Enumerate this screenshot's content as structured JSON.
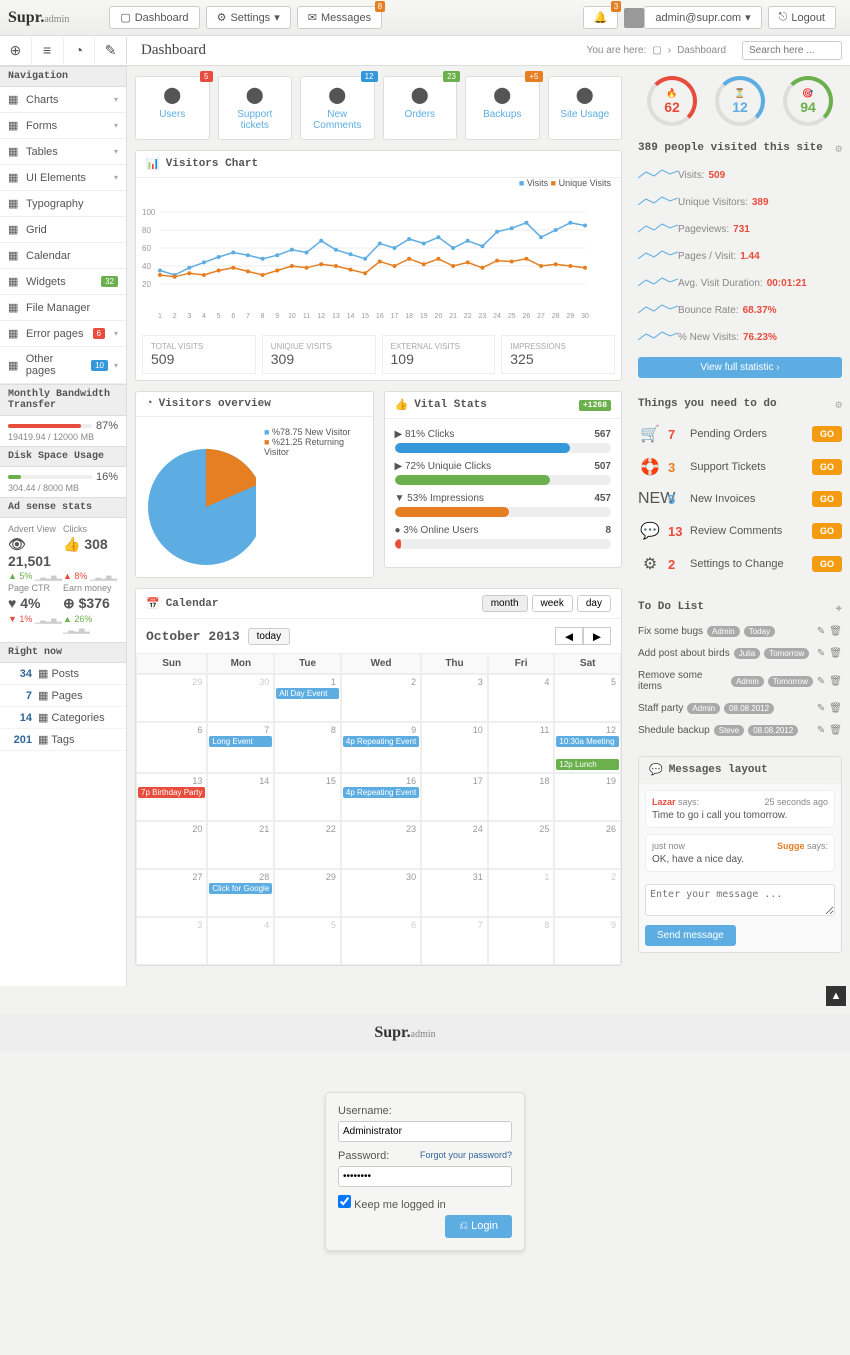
{
  "brand": {
    "main": "Supr.",
    "sub": "admin"
  },
  "header": {
    "dashboard": "Dashboard",
    "settings": "Settings",
    "messages": "Messages",
    "messages_badge": "8",
    "notif_badge": "3",
    "user": "admin@supr.com",
    "logout": "Logout"
  },
  "toolbar": {
    "title": "Dashboard",
    "you_are_here": "You are here:",
    "crumb": "Dashboard",
    "search_ph": "Search here ..."
  },
  "nav": {
    "title": "Navigation",
    "items": [
      {
        "label": "Charts",
        "caret": true
      },
      {
        "label": "Forms",
        "caret": true
      },
      {
        "label": "Tables",
        "caret": true
      },
      {
        "label": "UI Elements",
        "caret": true
      },
      {
        "label": "Typography"
      },
      {
        "label": "Grid"
      },
      {
        "label": "Calendar"
      },
      {
        "label": "Widgets",
        "badge": "32",
        "cls": "green"
      },
      {
        "label": "File Manager"
      },
      {
        "label": "Error pages",
        "badge": "6",
        "cls": "red",
        "caret": true
      },
      {
        "label": "Other pages",
        "badge": "10",
        "cls": "blue",
        "caret": true
      }
    ]
  },
  "bandwidth": {
    "title": "Monthly Bandwidth Transfer",
    "text": "19419.94 / 12000 MB",
    "pct": "87%",
    "fill": 87
  },
  "disk": {
    "title": "Disk Space Usage",
    "text": "304.44 / 8000 MB",
    "pct": "16%",
    "fill": 16
  },
  "adsense": {
    "title": "Ad sense stats",
    "col1": {
      "label": "Advert View",
      "num": "21,501",
      "delta": "5%"
    },
    "col2": {
      "label": "Clicks",
      "num": "308",
      "delta": "8%"
    },
    "col3": {
      "label": "Page CTR",
      "num": "4%",
      "delta": ""
    },
    "col4": {
      "label": "Earn money",
      "num": "$376",
      "delta": "26%"
    }
  },
  "rightnow": {
    "title": "Right now",
    "rows": [
      {
        "n": "34",
        "label": "Posts"
      },
      {
        "n": "7",
        "label": "Pages"
      },
      {
        "n": "14",
        "label": "Categories"
      },
      {
        "n": "201",
        "label": "Tags"
      }
    ]
  },
  "tiles": [
    {
      "label": "Users",
      "badge": "5",
      "cls": "red",
      "color": "#5dade2"
    },
    {
      "label": "Support tickets",
      "color": "#5dade2"
    },
    {
      "label": "New Comments",
      "badge": "12",
      "cls": "blue",
      "color": "#5dade2"
    },
    {
      "label": "Orders",
      "badge": "23",
      "cls": "green",
      "color": "#5dade2"
    },
    {
      "label": "Backups",
      "badge": "+5",
      "cls": "orange",
      "color": "#5dade2"
    },
    {
      "label": "Site Usage",
      "color": "#5dade2"
    }
  ],
  "chart": {
    "title": "Visitors Chart",
    "legend": [
      "Visits",
      "Unique Visits"
    ],
    "y_ticks": [
      20,
      40,
      60,
      80,
      100
    ],
    "x_ticks": [
      "1",
      "2",
      "3",
      "4",
      "5",
      "6",
      "7",
      "8",
      "9",
      "10",
      "11",
      "12",
      "13",
      "14",
      "15",
      "16",
      "17",
      "18",
      "19",
      "20",
      "21",
      "22",
      "23",
      "24",
      "25",
      "26",
      "27",
      "28",
      "29",
      "30"
    ],
    "stats": [
      {
        "label": "TOTAL VISITS",
        "value": "509"
      },
      {
        "label": "UNIQIUE VISITS",
        "value": "309"
      },
      {
        "label": "EXTERNAL VISITS",
        "value": "109"
      },
      {
        "label": "IMPRESSIONS",
        "value": "325"
      }
    ]
  },
  "chart_data": {
    "type": "line",
    "x": [
      1,
      2,
      3,
      4,
      5,
      6,
      7,
      8,
      9,
      10,
      11,
      12,
      13,
      14,
      15,
      16,
      17,
      18,
      19,
      20,
      21,
      22,
      23,
      24,
      25,
      26,
      27,
      28,
      29,
      30
    ],
    "series": [
      {
        "name": "Visits",
        "color": "#5dade2",
        "values": [
          35,
          30,
          38,
          44,
          50,
          55,
          52,
          48,
          52,
          58,
          55,
          68,
          58,
          53,
          48,
          65,
          60,
          70,
          65,
          72,
          60,
          68,
          62,
          78,
          82,
          88,
          72,
          80,
          88,
          85
        ]
      },
      {
        "name": "Unique Visits",
        "color": "#e67e22",
        "values": [
          30,
          28,
          32,
          30,
          35,
          38,
          34,
          30,
          35,
          40,
          38,
          42,
          40,
          36,
          32,
          45,
          40,
          48,
          42,
          48,
          40,
          44,
          38,
          46,
          45,
          48,
          40,
          42,
          40,
          38
        ]
      }
    ],
    "ylim": [
      0,
      100
    ],
    "pie": {
      "type": "pie",
      "slices": [
        {
          "label": "%78.75 New Visitor",
          "value": 78.75,
          "color": "#5dade2"
        },
        {
          "label": "%21.25 Returning Visitor",
          "value": 21.25,
          "color": "#e67e22"
        }
      ]
    }
  },
  "overview": {
    "title": "Visitors overview"
  },
  "vital": {
    "title": "Vital Stats",
    "badge": "+1268",
    "rows": [
      {
        "caret": "▶",
        "label": "81% Clicks",
        "val": "567",
        "pct": 81,
        "color": "#3498db"
      },
      {
        "caret": "▶",
        "label": "72% Uniquie Clicks",
        "val": "507",
        "pct": 72,
        "color": "#6ab04c"
      },
      {
        "caret": "▼",
        "label": "53% Impressions",
        "val": "457",
        "pct": 53,
        "color": "#e67e22"
      },
      {
        "caret": "●",
        "label": "3% Online Users",
        "val": "8",
        "pct": 3,
        "color": "#e74c3c"
      }
    ]
  },
  "gauges": [
    {
      "num": "62",
      "color": "#e74c3c",
      "icon": "🔥"
    },
    {
      "num": "12",
      "color": "#5dade2",
      "icon": "⏳"
    },
    {
      "num": "94",
      "color": "#6ab04c",
      "icon": "🎯"
    }
  ],
  "site_stats": {
    "title": "389 people visited this site",
    "rows": [
      {
        "label": "Visits:",
        "val": "509"
      },
      {
        "label": "Unique Visitors:",
        "val": "389"
      },
      {
        "label": "Pageviews:",
        "val": "731"
      },
      {
        "label": "Pages / Visit:",
        "val": "1.44"
      },
      {
        "label": "Avg. Visit Duration:",
        "val": "00:01:21"
      },
      {
        "label": "Bounce Rate:",
        "val": "68.37%"
      },
      {
        "label": "% New Visits:",
        "val": "76.23%"
      }
    ],
    "button": "View full statistic ›"
  },
  "actions": {
    "title": "Things you need to do",
    "rows": [
      {
        "icon": "🛒",
        "num": "7",
        "label": "Pending Orders",
        "color": "#e74c3c"
      },
      {
        "icon": "🛟",
        "num": "3",
        "label": "Support Tickets",
        "color": "#e67e22"
      },
      {
        "icon": "NEW",
        "num": "5",
        "label": "New Invoices",
        "color": "#5dade2"
      },
      {
        "icon": "💬",
        "num": "13",
        "label": "Review Comments",
        "color": "#e74c3c"
      },
      {
        "icon": "⚙",
        "num": "2",
        "label": "Settings to Change",
        "color": "#e74c3c"
      }
    ],
    "go": "GO"
  },
  "todolist": {
    "title": "To Do List",
    "items": [
      {
        "text": "Fix some bugs",
        "who": "Admin",
        "when": "Today",
        "wcls": "red"
      },
      {
        "text": "Add post about birds",
        "who": "Julia",
        "when": "Tomorrow",
        "wcls": "green"
      },
      {
        "text": "Remove some items",
        "who": "Admin",
        "when": "Tomorrow",
        "wcls": "green"
      },
      {
        "text": "Staff party",
        "who": "Admin",
        "when": "08.08.2012",
        "wcls": "blue"
      },
      {
        "text": "Shedule backup",
        "who": "Steve",
        "when": "08.08.2012",
        "wcls": "blue"
      }
    ]
  },
  "calendar": {
    "title": "Calendar",
    "month": "October 2013",
    "today": "today",
    "views": [
      "month",
      "week",
      "day"
    ],
    "days": [
      "Sun",
      "Mon",
      "Tue",
      "Wed",
      "Thu",
      "Fri",
      "Sat"
    ],
    "cells": [
      {
        "n": "29",
        "o": 1
      },
      {
        "n": "30",
        "o": 1
      },
      {
        "n": "1",
        "evts": [
          {
            "t": "All Day Event",
            "c": "#5dade2"
          }
        ]
      },
      {
        "n": "2"
      },
      {
        "n": "3"
      },
      {
        "n": "4"
      },
      {
        "n": "5"
      },
      {
        "n": "6"
      },
      {
        "n": "7",
        "evts": [
          {
            "t": "Long Event",
            "c": "#5dade2",
            "span": 3
          }
        ]
      },
      {
        "n": "8"
      },
      {
        "n": "9",
        "evts": [
          {
            "t": "4p Repeating Event",
            "c": "#5dade2"
          }
        ]
      },
      {
        "n": "10"
      },
      {
        "n": "11"
      },
      {
        "n": "12",
        "evts": [
          {
            "t": "10:30a Meeting",
            "c": "#5dade2"
          },
          {
            "t": "12p Lunch",
            "c": "#6ab04c"
          }
        ]
      },
      {
        "n": "13",
        "evts": [
          {
            "t": "7p Birthday Party",
            "c": "#e74c3c"
          }
        ]
      },
      {
        "n": "14"
      },
      {
        "n": "15"
      },
      {
        "n": "16",
        "evts": [
          {
            "t": "4p Repeating Event",
            "c": "#5dade2"
          }
        ]
      },
      {
        "n": "17"
      },
      {
        "n": "18"
      },
      {
        "n": "19"
      },
      {
        "n": "20"
      },
      {
        "n": "21"
      },
      {
        "n": "22"
      },
      {
        "n": "23"
      },
      {
        "n": "24"
      },
      {
        "n": "25"
      },
      {
        "n": "26"
      },
      {
        "n": "27"
      },
      {
        "n": "28",
        "evts": [
          {
            "t": "Click for Google",
            "c": "#5dade2"
          }
        ]
      },
      {
        "n": "29"
      },
      {
        "n": "30"
      },
      {
        "n": "31"
      },
      {
        "n": "1",
        "o": 1
      },
      {
        "n": "2",
        "o": 1
      },
      {
        "n": "3",
        "o": 1
      },
      {
        "n": "4",
        "o": 1
      },
      {
        "n": "5",
        "o": 1
      },
      {
        "n": "6",
        "o": 1
      },
      {
        "n": "7",
        "o": 1
      },
      {
        "n": "8",
        "o": 1
      },
      {
        "n": "9",
        "o": 1
      }
    ]
  },
  "messages": {
    "title": "Messages layout",
    "msgs": [
      {
        "who": "Lazar",
        "says": "says:",
        "time": "25 seconds ago",
        "text": "Time to go i call you tomorrow.",
        "whocolor": "#e74c3c"
      },
      {
        "who": "Sugge",
        "says": "says:",
        "time": "just now",
        "text": "OK, have a nice day.",
        "whocolor": "#e67e22",
        "right": true
      }
    ],
    "placeholder": "Enter your message ...",
    "send": "Send message"
  },
  "login": {
    "user_label": "Username:",
    "user_val": "Administrator",
    "pass_label": "Password:",
    "pass_val": "********",
    "forgot": "Forgot your password?",
    "keep": "Keep me logged in",
    "login": "Login"
  }
}
